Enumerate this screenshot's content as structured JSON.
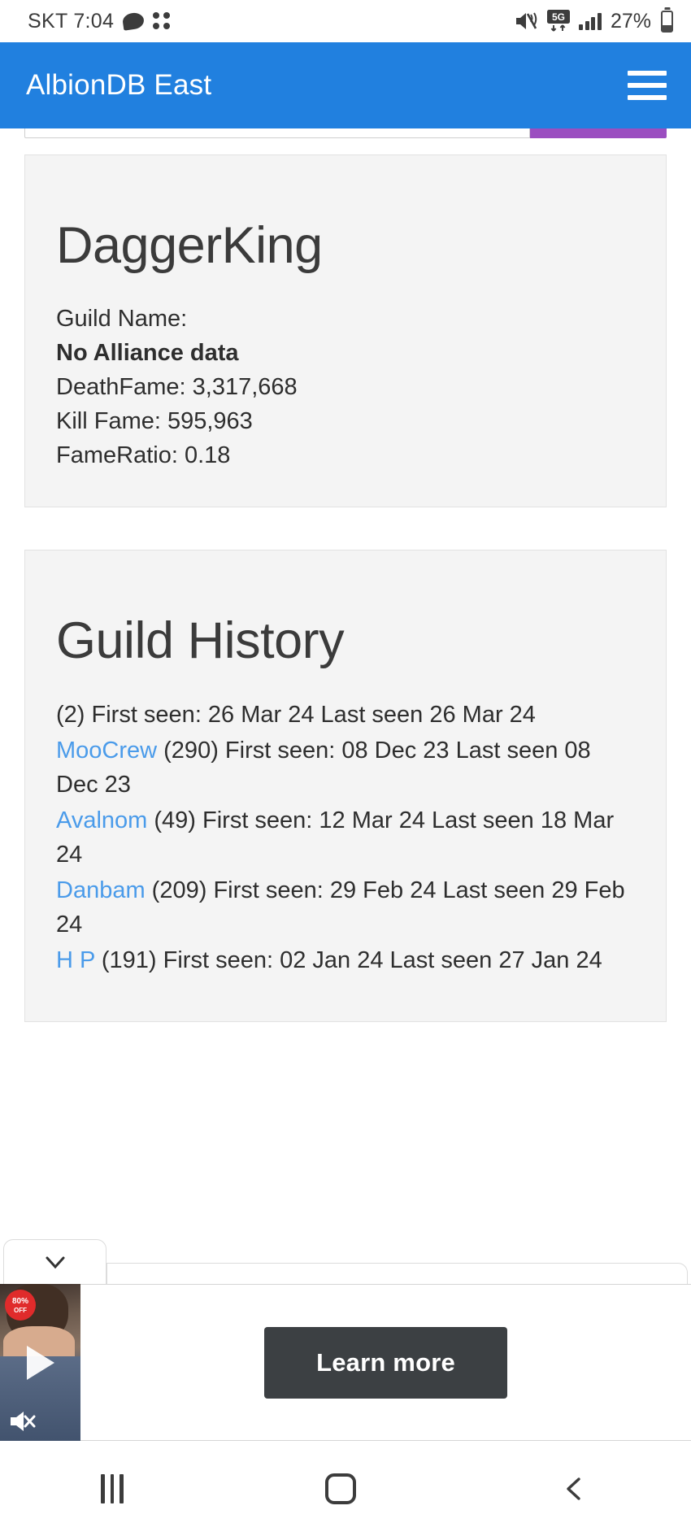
{
  "status_bar": {
    "carrier_time": "SKT 7:04",
    "battery_percent": "27%",
    "icons": [
      "speech-bubble-icon",
      "app-dots-icon",
      "mute-vibrate-icon",
      "5g-network-icon",
      "signal-bars-icon",
      "battery-icon"
    ]
  },
  "app_header": {
    "title": "AlbionDB East",
    "menu_icon": "hamburger-menu-icon"
  },
  "search": {
    "placeholder": "",
    "value": "",
    "button_label": "",
    "button_color": "#9b4ec0"
  },
  "profile_card": {
    "title": "DaggerKing",
    "lines": [
      {
        "text": "Guild Name:",
        "bold": false
      },
      {
        "text": "No Alliance data",
        "bold": true
      },
      {
        "text": "DeathFame: 3,317,668",
        "bold": false
      },
      {
        "text": "Kill Fame: 595,963",
        "bold": false
      },
      {
        "text": "FameRatio: 0.18",
        "bold": false
      }
    ]
  },
  "history_card": {
    "title": "Guild History",
    "entries": [
      {
        "link": "",
        "rest": "(2) First seen: 26 Mar 24 Last seen 26 Mar 24"
      },
      {
        "link": "MooCrew",
        "rest": " (290) First seen: 08 Dec 23 Last seen 08 Dec 23"
      },
      {
        "link": "Avalnom",
        "rest": " (49) First seen: 12 Mar 24 Last seen 18 Mar 24"
      },
      {
        "link": "Danbam",
        "rest": " (209) First seen: 29 Feb 24 Last seen 29 Feb 24"
      },
      {
        "link": "H P",
        "rest": " (191) First seen: 02 Jan 24 Last seen 27 Jan 24"
      }
    ]
  },
  "ad": {
    "collapse_icon": "chevron-down-icon",
    "play_icon": "play-icon",
    "mute_icon": "mute-icon",
    "discount_badge": "80% OFF",
    "cta_label": "Learn more"
  },
  "nav_bar": {
    "recents_icon": "recents-icon",
    "home_icon": "home-icon",
    "back_icon": "back-icon"
  },
  "colors": {
    "header_blue": "#2180df",
    "link_blue": "#4a9bea",
    "card_bg": "#f4f4f4",
    "cta_dark": "#3c4043"
  }
}
